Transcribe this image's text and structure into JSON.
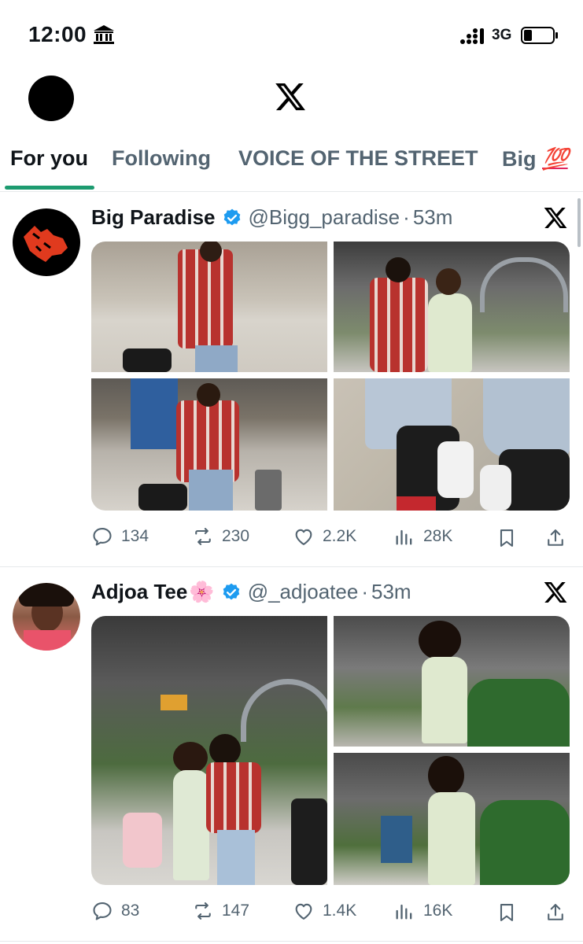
{
  "status_bar": {
    "time": "12:00",
    "network": "3G",
    "icons": [
      "bank-icon",
      "signal-icon",
      "battery-icon"
    ]
  },
  "header": {
    "logo": "x-logo"
  },
  "tabs": [
    {
      "label": "For you",
      "active": true
    },
    {
      "label": "Following",
      "active": false
    },
    {
      "label": "VOICE OF THE STREET",
      "active": false
    },
    {
      "label": "Big",
      "emoji": "💯",
      "active": false
    }
  ],
  "posts": [
    {
      "author": "Big Paradise",
      "handle": "@Bigg_paradise",
      "separator": "·",
      "time": "53m",
      "verified": true,
      "images": 4,
      "stats": {
        "replies": "134",
        "reposts": "230",
        "likes": "2.2K",
        "views": "28K"
      }
    },
    {
      "author": "Adjoa Tee",
      "author_emoji": "🌸",
      "handle": "@_adjoatee",
      "separator": "·",
      "time": "53m",
      "verified": true,
      "images": 3,
      "stats": {
        "replies": "83",
        "reposts": "147",
        "likes": "1.4K",
        "views": "16K"
      }
    }
  ],
  "colors": {
    "accent": "#1d9b70",
    "verified": "#1d9bf0",
    "text": "#0f1419",
    "muted": "#536471"
  }
}
